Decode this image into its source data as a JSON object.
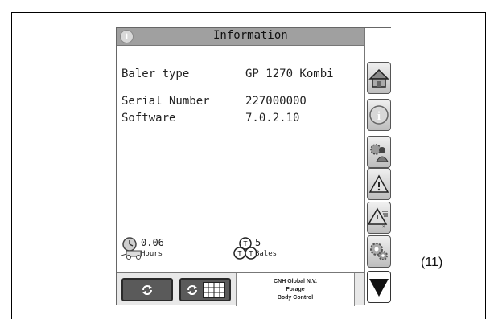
{
  "header": {
    "title": "Information"
  },
  "info": {
    "baler_type_label": "Baler type",
    "baler_type_value": "GP 1270 Kombi",
    "serial_label": "Serial Number",
    "serial_value": "227000000",
    "software_label": "Software",
    "software_value": "7.0.2.10"
  },
  "stats": {
    "hours_value": "0.06",
    "hours_label": "Hours",
    "bales_value": "5",
    "bales_label": "Bales"
  },
  "footer": {
    "company_line1": "CNH Global N.V.",
    "company_line2": "Forage",
    "company_line3": "Body Control"
  },
  "sidebar": {
    "buttons": [
      "home-icon",
      "info-icon",
      "operator-settings-icon",
      "warning-icon",
      "warning-list-icon",
      "settings-gears-icon",
      "arrow-down-icon"
    ]
  },
  "figure_caption": "(11)",
  "colors": {
    "titlebar": "#a0a0a0",
    "button_dark": "#5a5a5a",
    "button_light": "#d8d8d8"
  }
}
